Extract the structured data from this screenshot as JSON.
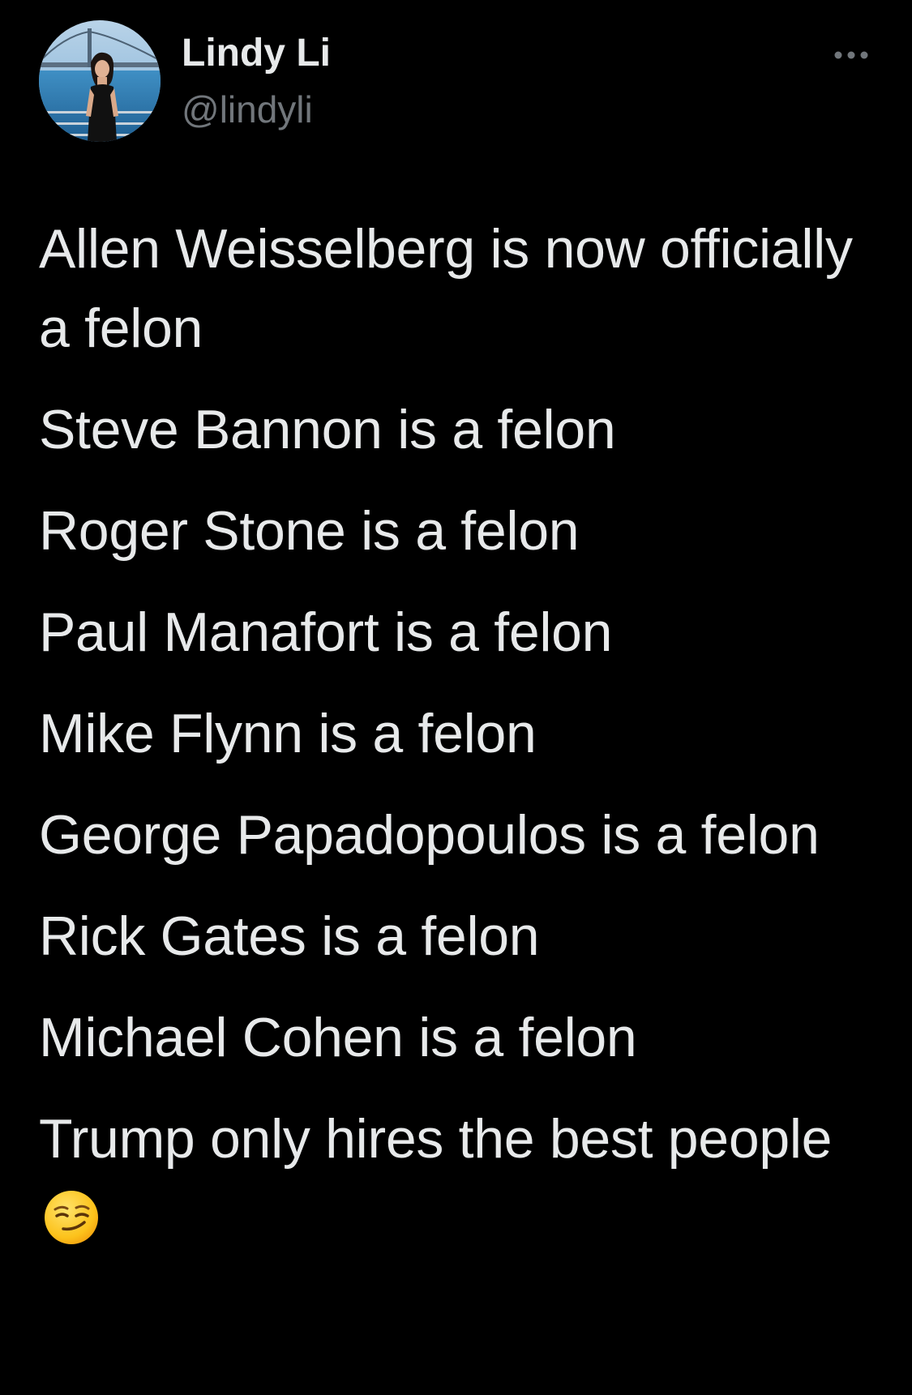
{
  "author": {
    "name": "Lindy Li",
    "handle": "@lindyli"
  },
  "icons": {
    "more": "more-dots-icon",
    "emoji": "smirking-face-emoji-icon"
  },
  "tweet": {
    "lines": [
      "Allen Weisselberg is now officially a felon",
      "Steve Bannon is a felon",
      "Roger Stone is a felon",
      "Paul Manafort is a felon",
      "Mike Flynn is a felon",
      "George Papadopoulos is a felon",
      "Rick Gates is a felon",
      "Michael Cohen is a felon"
    ],
    "closing": "Trump only hires the best people",
    "closing_emoji": "😏"
  },
  "colors": {
    "background": "#000000",
    "text_primary": "#e7e9ea",
    "text_secondary": "#71767b"
  }
}
